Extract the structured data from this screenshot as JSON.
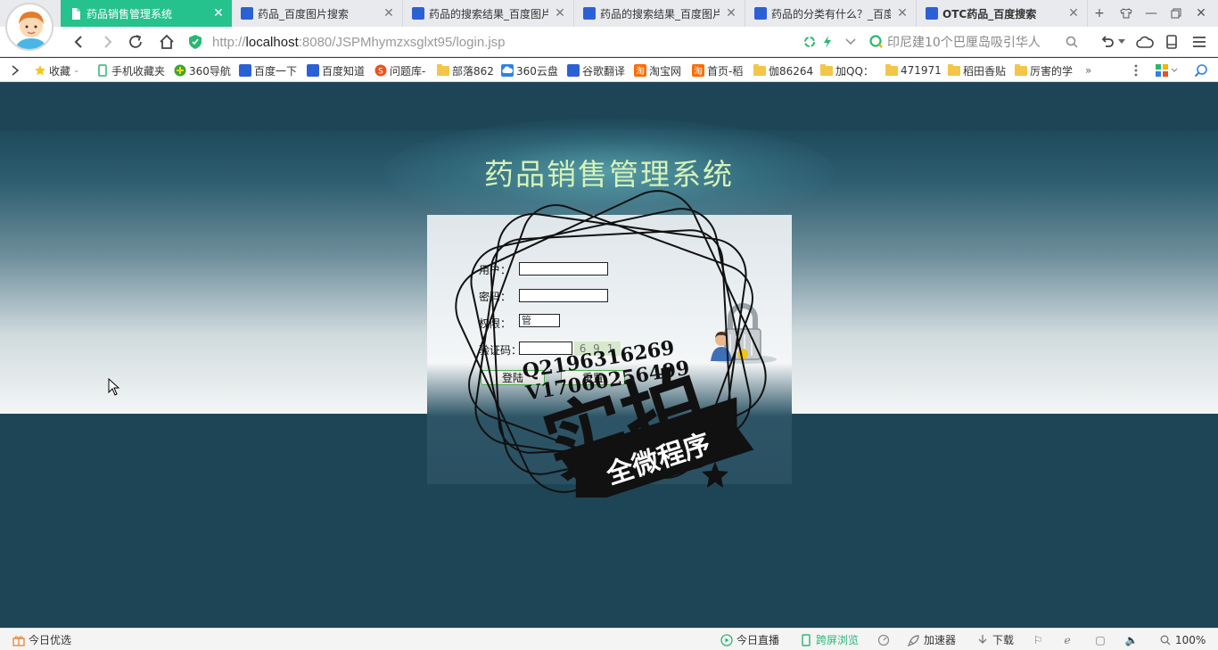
{
  "browser": {
    "tabs": [
      {
        "label": "药品销售管理系统",
        "active": true
      },
      {
        "label": "药品_百度图片搜索"
      },
      {
        "label": "药品的搜索结果_百度图片"
      },
      {
        "label": "药品的搜索结果_百度图片"
      },
      {
        "label": "药品的分类有什么？_百度"
      },
      {
        "label": "OTC药品_百度搜索"
      }
    ],
    "address": {
      "url_prefix": "http://",
      "url_host": "localhost",
      "url_rest": ":8080/JSPMhymzxsglxt95/login.jsp"
    },
    "search": {
      "text": "印尼建10个巴厘岛吸引华人"
    },
    "bookmarks": [
      {
        "label": "收藏"
      },
      {
        "label": "手机收藏夹"
      },
      {
        "label": "360导航"
      },
      {
        "label": "百度一下"
      },
      {
        "label": "百度知道"
      },
      {
        "label": "问题库-"
      },
      {
        "label": "部落862"
      },
      {
        "label": "360云盘"
      },
      {
        "label": "谷歌翻译"
      },
      {
        "label": "淘宝网"
      },
      {
        "label": "首页-稻"
      },
      {
        "label": "伽86264"
      },
      {
        "label": "加QQ："
      },
      {
        "label": "471971"
      },
      {
        "label": "稻田香贴"
      },
      {
        "label": "厉害的学"
      }
    ],
    "more_bookmarks": "»"
  },
  "page": {
    "title": "药品销售管理系统",
    "form": {
      "username_label": "用户：",
      "password_label": "密码：",
      "role_label": "权限：",
      "role_value": "管",
      "captcha_label": "验证码：",
      "captcha_image_text": "6 9 1",
      "login_button": "登陆",
      "reset_button": "重置"
    },
    "watermark": {
      "line1": "Q2196316269",
      "line2": "V17060256499",
      "big_text": "实拍",
      "ribbon_text": "全微程序"
    }
  },
  "statusbar": {
    "left": "今日优选",
    "items": [
      {
        "label": "今日直播"
      },
      {
        "label": "跨屏浏览"
      },
      {
        "label": "加速器"
      },
      {
        "label": "下载"
      }
    ],
    "zoom": "100%"
  },
  "colors": {
    "tab_active": "#26c28e",
    "page_bg": "#1e4556",
    "title_text": "#d6f2b8"
  }
}
